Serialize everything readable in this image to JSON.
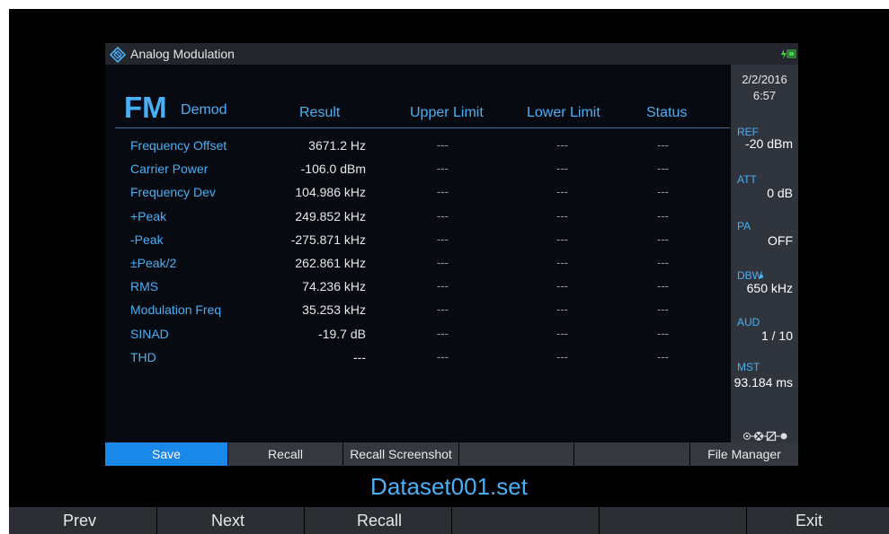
{
  "app": {
    "title": "Analog Modulation"
  },
  "header": {
    "mode": "FM",
    "demod": "Demod",
    "columns": [
      "Result",
      "Upper Limit",
      "Lower Limit",
      "Status"
    ]
  },
  "table": {
    "rows": [
      {
        "label": "Frequency Offset",
        "result": "3671.2 Hz",
        "upper": "---",
        "lower": "---",
        "status": "---"
      },
      {
        "label": "Carrier Power",
        "result": "-106.0 dBm",
        "upper": "---",
        "lower": "---",
        "status": "---"
      },
      {
        "label": "Frequency Dev",
        "result": "104.986 kHz",
        "upper": "---",
        "lower": "---",
        "status": "---"
      },
      {
        "label": "+Peak",
        "result": "249.852 kHz",
        "upper": "---",
        "lower": "---",
        "status": "---"
      },
      {
        "label": "-Peak",
        "result": "-275.871 kHz",
        "upper": "---",
        "lower": "---",
        "status": "---"
      },
      {
        "label": "±Peak/2",
        "result": "262.861 kHz",
        "upper": "---",
        "lower": "---",
        "status": "---"
      },
      {
        "label": "RMS",
        "result": "74.236 kHz",
        "upper": "---",
        "lower": "---",
        "status": "---"
      },
      {
        "label": "Modulation Freq",
        "result": "35.253 kHz",
        "upper": "---",
        "lower": "---",
        "status": "---"
      },
      {
        "label": "SINAD",
        "result": "-19.7 dB",
        "upper": "---",
        "lower": "---",
        "status": "---"
      },
      {
        "label": "THD",
        "result": "---",
        "upper": "---",
        "lower": "---",
        "status": "---"
      }
    ]
  },
  "side": {
    "date": "2/2/2016",
    "time": "6:57",
    "ref_label": "REF",
    "ref_value": "-20 dBm",
    "att_label": "ATT",
    "att_value": "0 dB",
    "pa_label": "PA",
    "pa_value": "OFF",
    "dbw_label": "DBW",
    "dbw_value": "650 kHz",
    "aud_label": "AUD",
    "aud_value": "1 / 10",
    "mst_label": "MST",
    "mst_value": "93.184 ms"
  },
  "softkeys": [
    "Save",
    "Recall",
    "Recall Screenshot",
    "",
    "",
    "File Manager"
  ],
  "filename": "Dataset001.set",
  "hardkeys": [
    "Prev",
    "Next",
    "Recall",
    "",
    "",
    "Exit"
  ],
  "colors": {
    "accent": "#4ab0f5",
    "active_softkey": "#1a88e8",
    "panel": "#2f343d"
  }
}
